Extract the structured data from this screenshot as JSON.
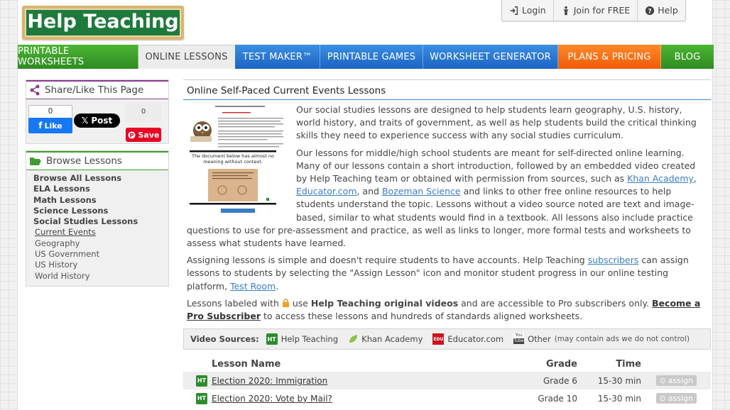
{
  "logo": {
    "text": "Help Teaching"
  },
  "toplinks": {
    "login": "Login",
    "join": "Join for FREE",
    "help": "Help"
  },
  "nav": [
    {
      "label": "PRINTABLE WORKSHEETS"
    },
    {
      "label": "ONLINE LESSONS"
    },
    {
      "label": "TEST MAKER™"
    },
    {
      "label": "PRINTABLE GAMES"
    },
    {
      "label": "WORKSHEET GENERATOR"
    },
    {
      "label": "PLANS & PRICING"
    },
    {
      "label": "BLOG"
    }
  ],
  "share": {
    "title": "Share/Like This Page",
    "fb_count": "0",
    "fb_label": "Like",
    "x_label": "Post",
    "pin_count": "0",
    "pin_label": "Save"
  },
  "browse": {
    "title": "Browse Lessons",
    "categories": [
      "Browse All Lessons",
      "ELA Lessons",
      "Math Lessons",
      "Science Lessons",
      "Social Studies Lessons"
    ],
    "subcategories": [
      "Current Events",
      "Geography",
      "US Government",
      "US History",
      "World History"
    ]
  },
  "main": {
    "title": "Online Self-Paced Current Events Lessons",
    "thumb_caption": "The document below has almost no meaning without context.",
    "p1": "Our social studies lessons are designed to help students learn geography, U.S. history, world history, and traits of government, as well as help students build the critical thinking skills they need to experience success with any social studies curriculum.",
    "p2_a": "Our lessons for middle/high school students are meant for self-directed online learning. Many of our lessons contain a short introduction, followed by an embedded video created by Help Teaching team or obtained with permission from sources, such as ",
    "p2_link1": "Khan Academy",
    "p2_comma": ", ",
    "p2_link2": "Educator.com",
    "p2_and": ", and ",
    "p2_link3": "Bozeman Science",
    "p2_b": " and links to other free online resources to help students understand the topic. Lessons without a video source noted are text and image-based, similar to what students would find in a textbook. All lessons also include practice questions to use for pre-assessment and practice, as well as links to longer, more formal tests and worksheets to assess what students have learned.",
    "p3_a": "Assigning lessons is simple and doesn't require students to have accounts. Help Teaching ",
    "p3_link1": "subscribers",
    "p3_b": " can assign lessons to students by selecting the \"Assign Lesson\" icon and monitor student progress in our online testing platform, ",
    "p3_link2": "Test Room",
    "p3_c": ".",
    "p4_a": "Lessons labeled with ",
    "p4_b": " use ",
    "p4_bold": "Help Teaching original videos",
    "p4_c": " and are accessible to Pro subscribers only. ",
    "p4_link": "Become a Pro Subscriber",
    "p4_d": " to access these lessons and hundreds of standards aligned worksheets."
  },
  "sources": {
    "label": "Video Sources:",
    "items": [
      {
        "name": "Help Teaching",
        "icon": "HT"
      },
      {
        "name": "Khan Academy",
        "icon": "leaf"
      },
      {
        "name": "Educator.com",
        "icon": "EDU"
      },
      {
        "name": "Other",
        "icon": "YouTube",
        "note": "(may contain ads we do not control)"
      }
    ]
  },
  "table": {
    "headers": {
      "name": "Lesson Name",
      "grade": "Grade",
      "time": "Time"
    },
    "rows": [
      {
        "badge": "HT",
        "name": "Election 2020: Immigration",
        "grade": "Grade 6",
        "time": "15-30 min",
        "action": "assign"
      },
      {
        "badge": "HT",
        "name": "Election 2020: Vote by Mail?",
        "grade": "Grade 10",
        "time": "15-30 min",
        "action": "assign"
      }
    ]
  },
  "colors": {
    "nav_green": "#3fa82c",
    "nav_blue": "#2a77d6",
    "nav_orange": "#f76e14",
    "link": "#3a7dc1",
    "ht_green": "#2e8b2e"
  }
}
